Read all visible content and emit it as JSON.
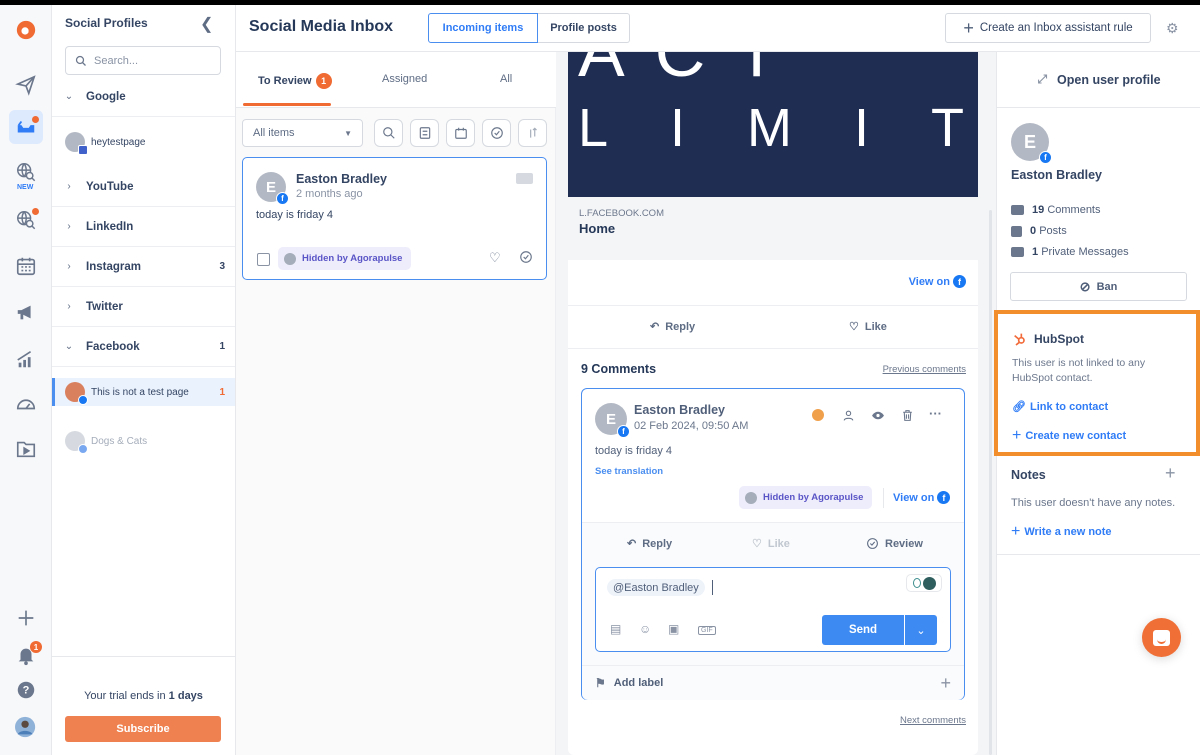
{
  "app": {
    "title": "Social Media Inbox"
  },
  "rail": {
    "new_label": "NEW",
    "notifications_count": "1",
    "icons": [
      "agorapulse-logo",
      "publish-icon",
      "inbox-icon",
      "listening-new-icon",
      "listening-icon",
      "calendar-icon",
      "ads-icon",
      "reports-icon",
      "dashboard-icon",
      "media-library-icon",
      "add-icon",
      "bell-icon",
      "help-icon",
      "user-avatar"
    ]
  },
  "profiles": {
    "title": "Social Profiles",
    "search_placeholder": "Search...",
    "networks": [
      {
        "label": "Google",
        "expanded": true,
        "count": ""
      },
      {
        "label": "YouTube",
        "expanded": false,
        "count": ""
      },
      {
        "label": "LinkedIn",
        "expanded": false,
        "count": ""
      },
      {
        "label": "Instagram",
        "expanded": false,
        "count": "3"
      },
      {
        "label": "Twitter",
        "expanded": false,
        "count": ""
      },
      {
        "label": "Facebook",
        "expanded": true,
        "count": "1"
      }
    ],
    "accounts": [
      {
        "name": "heytestpage",
        "count": ""
      },
      {
        "name": "This is not a test page",
        "count": "1"
      },
      {
        "name": "Dogs & Cats",
        "count": ""
      }
    ],
    "trial_prefix": "Your trial ends in ",
    "trial_days": "1 days",
    "subscribe_label": "Subscribe"
  },
  "header": {
    "tabs": [
      "Incoming items",
      "Profile posts"
    ],
    "active_tab": "Incoming items",
    "rule_button": "Create an Inbox assistant rule"
  },
  "list": {
    "tabs": [
      {
        "label": "To Review",
        "badge": "1"
      },
      {
        "label": "Assigned",
        "badge": ""
      },
      {
        "label": "All",
        "badge": ""
      }
    ],
    "filter_value": "All items",
    "items": [
      {
        "author": "Easton Bradley",
        "avatar_letter": "E",
        "time": "2 months ago",
        "text": "today is friday 4",
        "status": "Hidden by Agorapulse"
      }
    ]
  },
  "post": {
    "banner_text_top": "ACT",
    "banner_text": "LIMIT",
    "link_domain": "L.FACEBOOK.COM",
    "link_title": "Home",
    "view_on_label": "View on",
    "reply_label": "Reply",
    "like_label": "Like",
    "comments_count_label": "9 Comments",
    "previous_comments": "Previous comments",
    "next_comments": "Next comments",
    "comment": {
      "author": "Easton Bradley",
      "avatar_letter": "E",
      "time": "02 Feb 2024, 09:50 AM",
      "text": "today is friday 4",
      "see_translation": "See translation",
      "status": "Hidden by Agorapulse",
      "view_on_label": "View on",
      "reply_label": "Reply",
      "like_label": "Like",
      "review_label": "Review"
    },
    "composer": {
      "mention": "@Easton Bradley",
      "send_label": "Send"
    },
    "add_label": "Add label"
  },
  "user_panel": {
    "open_profile": "Open user profile",
    "avatar_letter": "E",
    "name": "Easton Bradley",
    "stats": [
      {
        "count": "19",
        "label": "Comments"
      },
      {
        "count": "0",
        "label": "Posts"
      },
      {
        "count": "1",
        "label": "Private Messages"
      }
    ],
    "ban_label": "Ban",
    "hubspot": {
      "title": "HubSpot",
      "description": "This user is not linked to any HubSpot contact.",
      "link_contact": "Link to contact",
      "create_contact": "Create new contact"
    },
    "notes": {
      "title": "Notes",
      "empty": "This user doesn't have any notes.",
      "write_note": "Write a new note"
    }
  },
  "colors": {
    "accent": "#f06a33",
    "primary": "#2f7cf6",
    "hubspot_highlight": "#f28f2c",
    "facebook": "#1877f2"
  }
}
